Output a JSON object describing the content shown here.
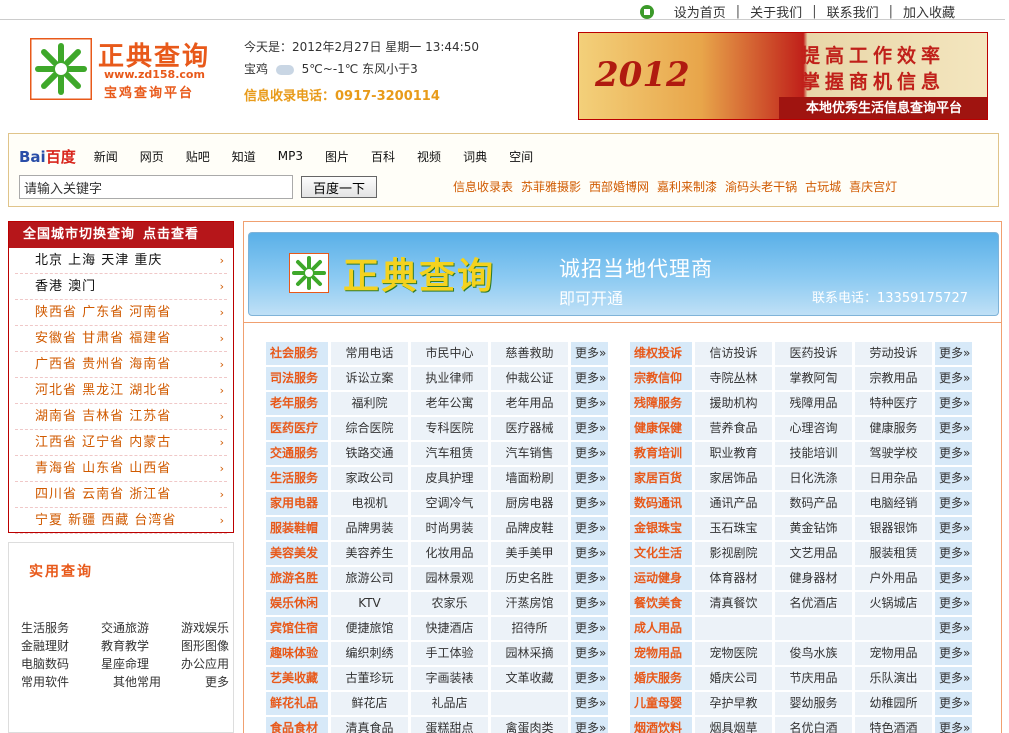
{
  "topbar": {
    "links": [
      "设为首页",
      "关于我们",
      "联系我们",
      "加入收藏"
    ]
  },
  "logo": {
    "name": "正典查询",
    "url": "www.zd158.com",
    "subtitle": "宝鸡查询平台"
  },
  "info": {
    "date": "今天是：2012年2月27日 星期一 13:44:50",
    "city": "宝鸡",
    "temp": "5℃~-1℃",
    "wind": "东风小于3",
    "phone": "信息收录电话：0917-3200114"
  },
  "banner": {
    "year": "2012",
    "line1": "提高工作效率",
    "line2": "掌握商机信息",
    "line3": "本地优秀生活信息查询平台"
  },
  "baidu": {
    "logo": "Bai",
    "logo2": "百度",
    "nav": [
      "新闻",
      "网页",
      "贴吧",
      "知道",
      "MP3",
      "图片",
      "百科",
      "视频",
      "词典",
      "空间"
    ],
    "search_value": "请输入关键字",
    "button": "百度一下",
    "hot": [
      "信息收录表",
      "苏菲雅摄影",
      "西部婚博网",
      "嘉利来制漆",
      "渝码头老干锅",
      "古玩城",
      "喜庆宫灯"
    ]
  },
  "citybox": {
    "title": "全国城市切换查询",
    "more": "点击查看",
    "rows": [
      "北京 上海 天津 重庆",
      "香港 澳门",
      "陕西省 广东省 河南省",
      "安徽省 甘肃省 福建省",
      "广西省 贵州省 海南省",
      "河北省 黑龙江 湖北省",
      "湖南省 吉林省 江苏省",
      "江西省 辽宁省 内蒙古",
      "青海省 山东省 山西省",
      "四川省 云南省 浙江省",
      "宁夏 新疆 西藏 台湾省"
    ]
  },
  "toolbox": {
    "title": "实用查询",
    "rows": [
      [
        "生活服务",
        "交通旅游",
        "游戏娱乐"
      ],
      [
        "金融理财",
        "教育教学",
        "图形图像"
      ],
      [
        "电脑数码",
        "星座命理",
        "办公应用"
      ],
      [
        "常用软件",
        "其他常用",
        "更多"
      ]
    ]
  },
  "agent": {
    "name": "正典查询",
    "line1": "诚招当地代理商",
    "line2": "即可开通",
    "tel": "联系电话：13359175727"
  },
  "more_label": "更多»",
  "categories_left": [
    {
      "label": "社会服务",
      "items": [
        "常用电话",
        "市民中心",
        "慈善救助"
      ]
    },
    {
      "label": "司法服务",
      "items": [
        "诉讼立案",
        "执业律师",
        "仲裁公证"
      ]
    },
    {
      "label": "老年服务",
      "items": [
        "福利院",
        "老年公寓",
        "老年用品"
      ]
    },
    {
      "label": "医药医疗",
      "items": [
        "综合医院",
        "专科医院",
        "医疗器械"
      ]
    },
    {
      "label": "交通服务",
      "items": [
        "铁路交通",
        "汽车租赁",
        "汽车销售"
      ]
    },
    {
      "label": "生活服务",
      "items": [
        "家政公司",
        "皮具护理",
        "墙面粉刷"
      ]
    },
    {
      "label": "家用电器",
      "items": [
        "电视机",
        "空调冷气",
        "厨房电器"
      ]
    },
    {
      "label": "服装鞋帽",
      "items": [
        "品牌男装",
        "时尚男装",
        "品牌皮鞋"
      ]
    },
    {
      "label": "美容美发",
      "items": [
        "美容养生",
        "化妆用品",
        "美手美甲"
      ]
    },
    {
      "label": "旅游名胜",
      "items": [
        "旅游公司",
        "园林景观",
        "历史名胜"
      ]
    },
    {
      "label": "娱乐休闲",
      "items": [
        "KTV",
        "农家乐",
        "汗蒸房馆"
      ]
    },
    {
      "label": "宾馆住宿",
      "items": [
        "便捷旅馆",
        "快捷酒店",
        "招待所"
      ]
    },
    {
      "label": "趣味体验",
      "items": [
        "编织刺绣",
        "手工体验",
        "园林采摘"
      ]
    },
    {
      "label": "艺美收藏",
      "items": [
        "古董珍玩",
        "字画装裱",
        "文革收藏"
      ]
    },
    {
      "label": "鲜花礼品",
      "items": [
        "鲜花店",
        "礼品店",
        ""
      ]
    },
    {
      "label": "食品食材",
      "items": [
        "清真食品",
        "蛋糕甜点",
        "禽蛋肉类"
      ]
    }
  ],
  "categories_right": [
    {
      "label": "维权投诉",
      "items": [
        "信访投诉",
        "医药投诉",
        "劳动投诉"
      ]
    },
    {
      "label": "宗教信仰",
      "items": [
        "寺院丛林",
        "掌教阿訇",
        "宗教用品"
      ]
    },
    {
      "label": "残障服务",
      "items": [
        "援助机构",
        "残障用品",
        "特种医疗"
      ]
    },
    {
      "label": "健康保健",
      "items": [
        "营养食品",
        "心理咨询",
        "健康服务"
      ]
    },
    {
      "label": "教育培训",
      "items": [
        "职业教育",
        "技能培训",
        "驾驶学校"
      ]
    },
    {
      "label": "家居百货",
      "items": [
        "家居饰品",
        "日化洗涤",
        "日用杂品"
      ]
    },
    {
      "label": "数码通讯",
      "items": [
        "通讯产品",
        "数码产品",
        "电脑经销"
      ]
    },
    {
      "label": "金银珠宝",
      "items": [
        "玉石珠宝",
        "黄金钻饰",
        "银器银饰"
      ]
    },
    {
      "label": "文化生活",
      "items": [
        "影视剧院",
        "文艺用品",
        "服装租赁"
      ]
    },
    {
      "label": "运动健身",
      "items": [
        "体育器材",
        "健身器材",
        "户外用品"
      ]
    },
    {
      "label": "餐饮美食",
      "items": [
        "清真餐饮",
        "名优酒店",
        "火锅城店"
      ]
    },
    {
      "label": "成人用品",
      "items": [
        "",
        "",
        ""
      ]
    },
    {
      "label": "宠物用品",
      "items": [
        "宠物医院",
        "俊鸟水族",
        "宠物用品"
      ]
    },
    {
      "label": "婚庆服务",
      "items": [
        "婚庆公司",
        "节庆用品",
        "乐队演出"
      ]
    },
    {
      "label": "儿童母婴",
      "items": [
        "孕护早教",
        "婴幼服务",
        "幼稚园所"
      ]
    },
    {
      "label": "烟酒饮料",
      "items": [
        "烟具烟草",
        "名优白酒",
        "特色酒酒"
      ]
    }
  ]
}
